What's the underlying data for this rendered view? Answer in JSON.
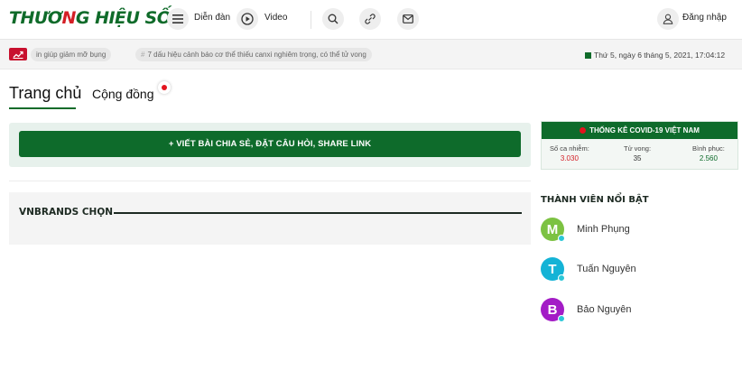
{
  "header": {
    "logo": {
      "part1": "THƯƠ",
      "mark": "N",
      "part2": "G HIỆU SỐ"
    },
    "menu_label": "Diễn đàn",
    "video_label": "Video",
    "login_label": "Đăng nhập",
    "icons": [
      "menu-icon",
      "play-icon",
      "search-icon",
      "link-icon",
      "mail-icon",
      "user-icon"
    ]
  },
  "ticker": {
    "items": [
      "in giúp giảm mỡ bụng",
      "7 dấu hiệu cảnh báo cơ thể thiếu canxi nghiêm trọng, có thể tử vong"
    ],
    "date": "Thứ 5, ngày 6 tháng 5, 2021, 17:04:12"
  },
  "tabs": {
    "home": "Trang chủ",
    "community": "Cộng đồng"
  },
  "post_button": "+ VIẾT BÀI CHIA SẺ, ĐẶT CÂU HỎI, SHARE LINK",
  "vnbrands_title": "VNBRANDS CHỌN",
  "covid": {
    "title": "THỐNG KÊ COVID-19 VIỆT NAM",
    "stats": [
      {
        "label": "Số ca nhiễm:",
        "value": "3.030",
        "color": "#d41f26"
      },
      {
        "label": "Tử vong:",
        "value": "35",
        "color": "#333333"
      },
      {
        "label": "Bình phục:",
        "value": "2.560",
        "color": "#0e6b2b"
      }
    ]
  },
  "members": {
    "title": "THÀNH VIÊN NỔI BẬT",
    "list": [
      {
        "initial": "M",
        "name": "Minh Phụng",
        "color": "#7cc242"
      },
      {
        "initial": "T",
        "name": "Tuấn Nguyên",
        "color": "#14b3d6"
      },
      {
        "initial": "B",
        "name": "Bảo Nguyên",
        "color": "#a31cc6"
      }
    ]
  },
  "colors": {
    "brand_green": "#0e6b2b",
    "brand_red": "#d41f26"
  }
}
